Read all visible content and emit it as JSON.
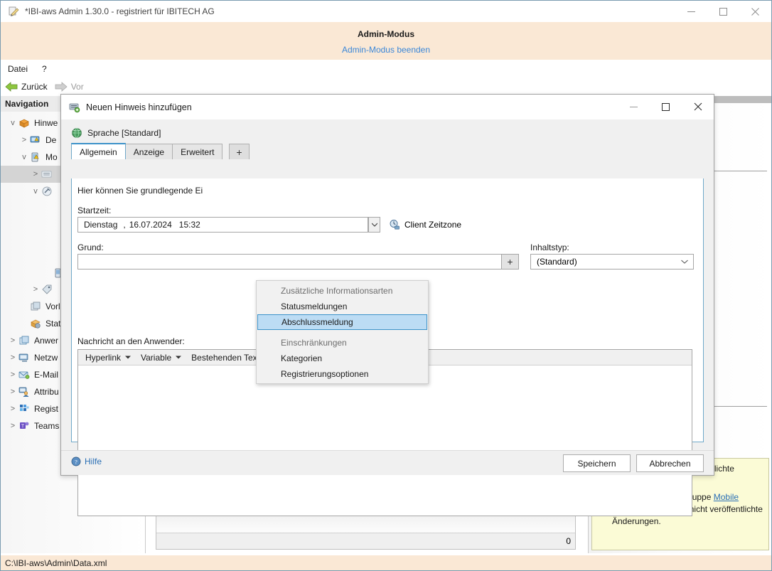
{
  "window": {
    "title": "*IBI-aws Admin 1.30.0 - registriert für IBITECH AG",
    "icon": "pen-document-icon",
    "controls": {
      "minimize": "—",
      "maximize": "☐",
      "close": "✕"
    }
  },
  "admin_banner": {
    "title": "Admin-Modus",
    "exit_link": "Admin-Modus beenden"
  },
  "menubar": {
    "items": [
      "Datei",
      "?"
    ]
  },
  "navbar": {
    "back": "Zurück",
    "forward": "Vor"
  },
  "sidebar": {
    "header": "Navigation",
    "items": [
      {
        "label": "Hinwe",
        "icon": "package-icon",
        "chevron": "v",
        "indent": 0
      },
      {
        "label": "De",
        "icon": "monitor-warning-icon",
        "chevron": ">",
        "indent": 1
      },
      {
        "label": "Mo",
        "icon": "mobile-warning-icon",
        "chevron": "v",
        "indent": 1
      },
      {
        "label": "",
        "icon": "list-icon",
        "chevron": ">",
        "indent": 2,
        "selected": true
      },
      {
        "label": "",
        "icon": "wrench-icon",
        "chevron": "v",
        "indent": 2
      },
      {
        "label": "",
        "icon": "",
        "chevron": "",
        "indent": 2
      },
      {
        "label": "",
        "icon": "phone-icon",
        "chevron": "",
        "indent": 3
      },
      {
        "label": "",
        "icon": "tag-icon",
        "chevron": ">",
        "indent": 3
      },
      {
        "label": "Vorlag",
        "icon": "templates-icon",
        "chevron": "",
        "indent": 1
      },
      {
        "label": "Statisc",
        "icon": "stats-gear-icon",
        "chevron": "",
        "indent": 1
      },
      {
        "label": "Anwer",
        "icon": "windows-icon",
        "chevron": ">",
        "indent": 0
      },
      {
        "label": "Netzw",
        "icon": "network-icon",
        "chevron": ">",
        "indent": 0
      },
      {
        "label": "E-Mail",
        "icon": "email-icon",
        "chevron": ">",
        "indent": 0
      },
      {
        "label": "Attribu",
        "icon": "attributes-user-icon",
        "chevron": ">",
        "indent": 0
      },
      {
        "label": "Regist",
        "icon": "registry-grid-icon",
        "chevron": ">",
        "indent": 0
      },
      {
        "label": "Teams",
        "icon": "teams-icon",
        "chevron": ">",
        "indent": 0
      }
    ]
  },
  "main": {
    "grid_count": "0"
  },
  "right_panel": {
    "notices": [
      {
        "icon": "info-icon",
        "text_before": "",
        "link": "",
        "text_after": "enthält noch nicht veröffentlichte Änderungen."
      },
      {
        "icon": "info-icon",
        "text_before": "Die mobile Hinweisgruppe ",
        "link": "Mobile Clients",
        "text_after": " enthält noch nicht veröffentlichte Änderungen."
      }
    ]
  },
  "statusbar": {
    "path": "C:\\IBI-aws\\Admin\\Data.xml"
  },
  "dialog": {
    "title": "Neuen Hinweis hinzufügen",
    "icon": "add-note-icon",
    "controls": {
      "minimize": "—",
      "maximize": "☐",
      "close": "✕"
    },
    "language": {
      "icon": "globe-icon",
      "label": "Sprache [Standard]"
    },
    "tabs": [
      {
        "label": "Allgemein",
        "active": true
      },
      {
        "label": "Anzeige",
        "active": false
      },
      {
        "label": "Erweitert",
        "active": false
      }
    ],
    "add_tab_label": "+",
    "hint": "Hier können Sie grundlegende Ei",
    "fields": {
      "starttime_label": "Startzeit:",
      "starttime_weekday": "Dienstag",
      "starttime_sep": ",",
      "starttime_date": "16.07.2024",
      "starttime_time": "15:32",
      "timezone_label": "Client Zeitzone",
      "timezone_icon": "clock-computer-icon",
      "reason_label": "Grund:",
      "reason_value": "",
      "reason_add_button": "+",
      "contenttype_label": "Inhaltstyp:",
      "contenttype_value": "(Standard)",
      "message_label": "Nachricht an den Anwender:"
    },
    "editor_toolbar": [
      {
        "label": "Hyperlink",
        "has_caret": true
      },
      {
        "label": "Variable",
        "has_caret": true
      },
      {
        "label": "Bestehenden Text übernehmen...",
        "has_caret": false
      }
    ],
    "editor_content": "",
    "footer": {
      "help": "Hilfe",
      "help_icon": "help-icon",
      "save": "Speichern",
      "cancel": "Abbrechen"
    }
  },
  "popup_menu": {
    "groups": [
      {
        "header": "Zusätzliche Informationsarten",
        "items": [
          {
            "label": "Statusmeldungen",
            "highlighted": false
          },
          {
            "label": "Abschlussmeldung",
            "highlighted": true
          }
        ]
      },
      {
        "header": "Einschränkungen",
        "items": [
          {
            "label": "Kategorien",
            "highlighted": false
          },
          {
            "label": "Registrierungsoptionen",
            "highlighted": false
          }
        ]
      }
    ]
  },
  "colors": {
    "banner": "#fae8d5",
    "accent_link": "#3b87d8",
    "selection": "#bcdcf4",
    "selection_border": "#3d92c9",
    "notice_bg": "#fbfbd6",
    "tab_active_border": "#3d92c9"
  }
}
